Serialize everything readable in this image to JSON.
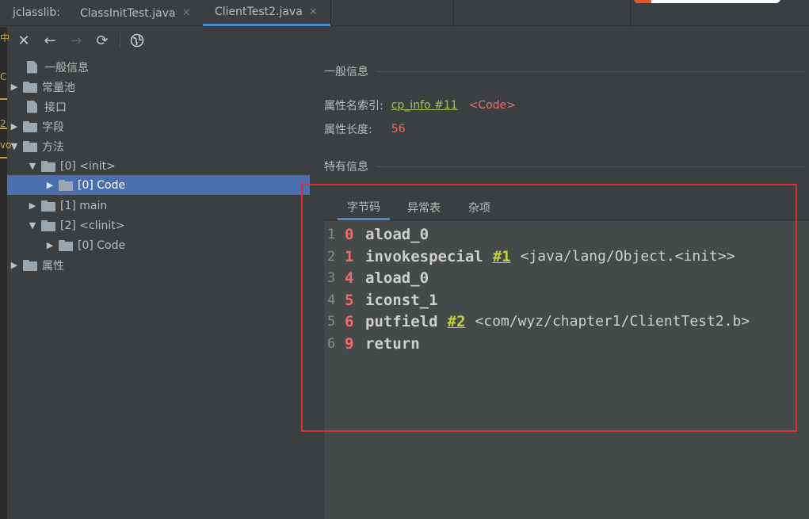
{
  "tabbar": {
    "plugin_label": "jclasslib:",
    "tabs": [
      {
        "label": "ClassInitTest.java",
        "close": "✕"
      },
      {
        "label": "ClientTest2.java",
        "close": "✕"
      }
    ]
  },
  "toolbar": {
    "close_icon": "✕",
    "back_icon": "←",
    "forward_icon": "→",
    "refresh_icon": "⟳",
    "web_icon": "globe"
  },
  "gutter": {
    "fragments": [
      "中",
      "C",
      "2",
      "vo"
    ]
  },
  "tree": {
    "nodes": [
      {
        "label": "一般信息"
      },
      {
        "label": "常量池"
      },
      {
        "label": "接口"
      },
      {
        "label": "字段"
      },
      {
        "label": "方法"
      },
      {
        "label": "[0] <init>"
      },
      {
        "label": "[0] Code"
      },
      {
        "label": "[1] main"
      },
      {
        "label": "[2] <clinit>"
      },
      {
        "label": "[0] Code"
      },
      {
        "label": "属性"
      }
    ]
  },
  "detail": {
    "general_title": "一般信息",
    "attr_name_index_label": "属性名索引:",
    "attr_name_index_link": "cp_info #11",
    "attr_name_index_value": "<Code>",
    "attr_length_label": "属性长度:",
    "attr_length_value": "56",
    "specific_title": "特有信息",
    "subtabs": [
      "字节码",
      "异常表",
      "杂项"
    ],
    "code": [
      {
        "line": "1",
        "pc": "0",
        "op": "aload_0",
        "ref": "",
        "comment": ""
      },
      {
        "line": "2",
        "pc": "1",
        "op": "invokespecial",
        "ref": "#1",
        "comment": "<java/lang/Object.<init>>"
      },
      {
        "line": "3",
        "pc": "4",
        "op": "aload_0",
        "ref": "",
        "comment": ""
      },
      {
        "line": "4",
        "pc": "5",
        "op": "iconst_1",
        "ref": "",
        "comment": ""
      },
      {
        "line": "5",
        "pc": "6",
        "op": "putfield",
        "ref": "#2",
        "comment": "<com/wyz/chapter1/ClientTest2.b>"
      },
      {
        "line": "6",
        "pc": "9",
        "op": "return",
        "ref": "",
        "comment": ""
      }
    ]
  },
  "colors": {
    "selection": "#4b6eaf",
    "accent_tab": "#4a88c7",
    "link": "#a5c25c",
    "value_red": "#eb6e6e",
    "annotation_box": "#d63232"
  }
}
